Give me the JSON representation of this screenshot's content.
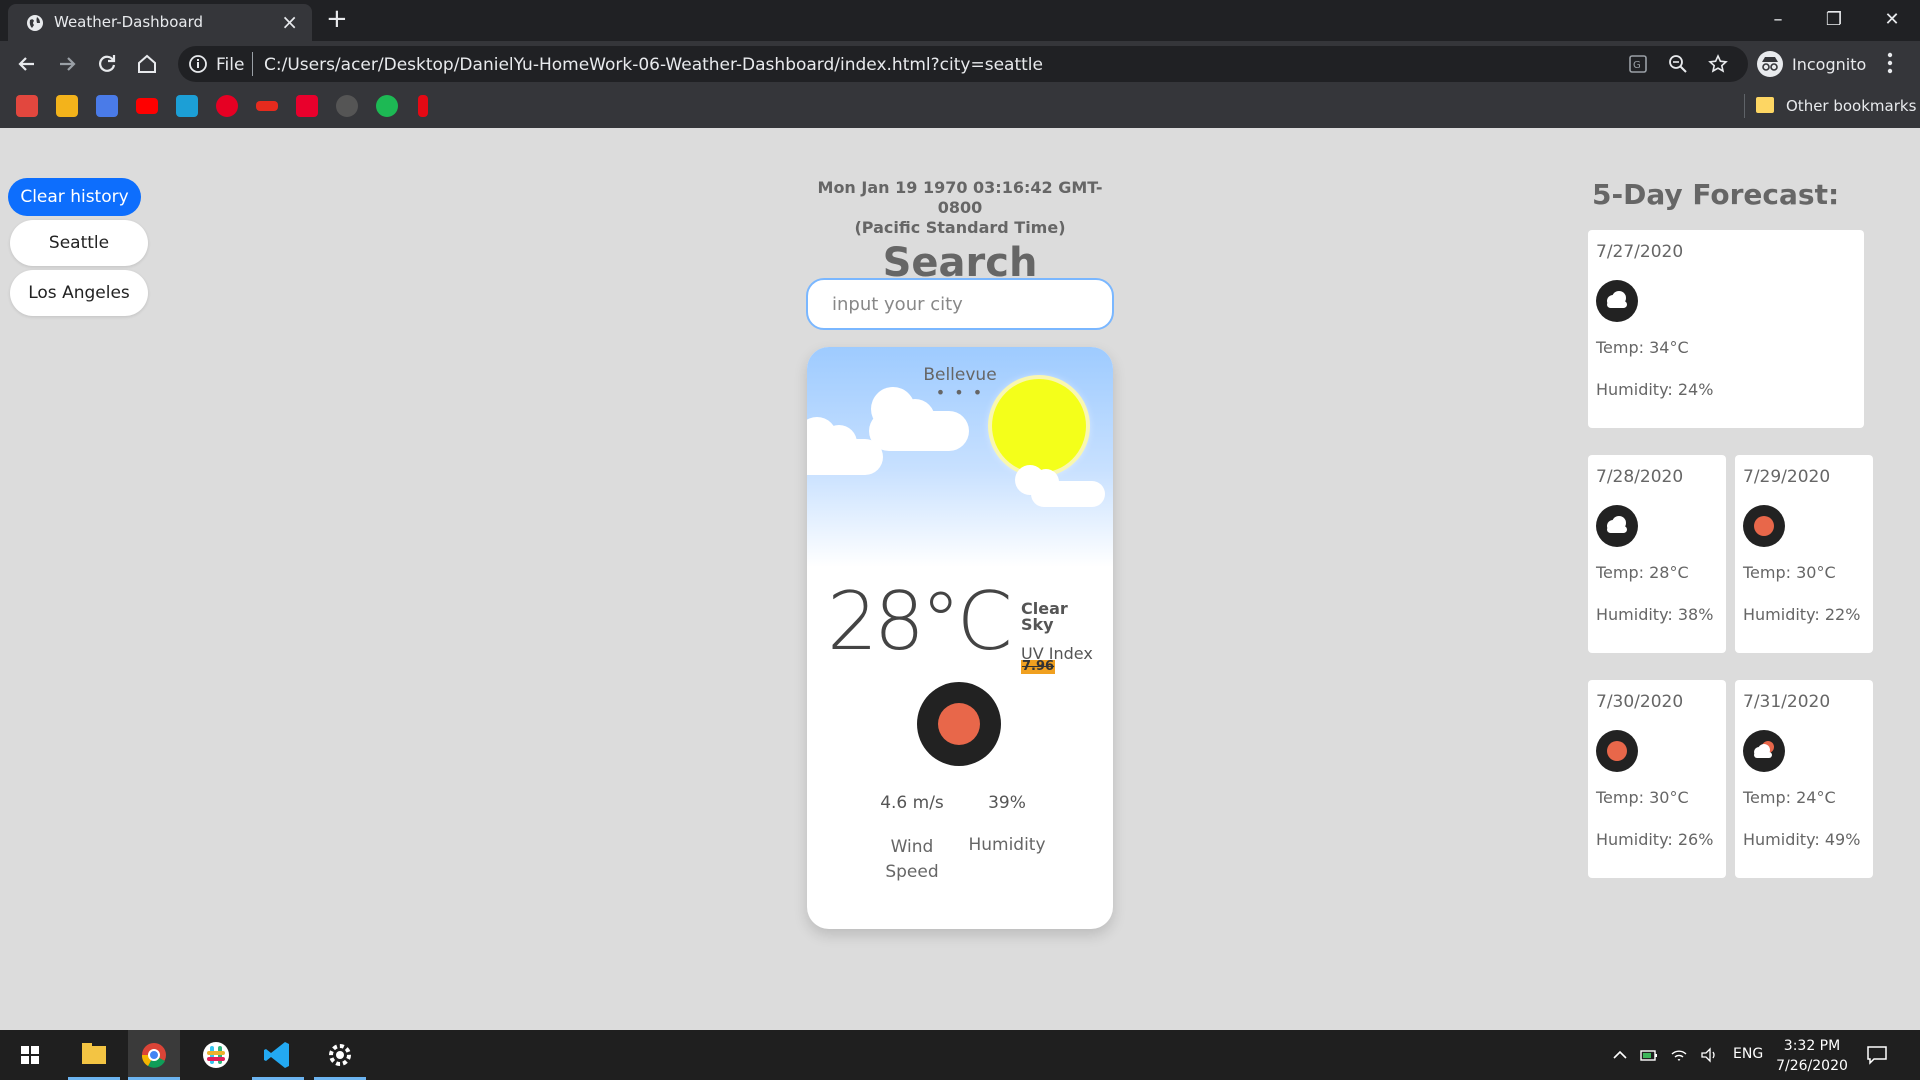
{
  "browser": {
    "tab_title": "Weather-Dashboard",
    "file_label": "File",
    "url": "C:/Users/acer/Desktop/DanielYu-HomeWork-06-Weather-Dashboard/index.html?city=seattle",
    "incognito_label": "Incognito",
    "other_bookmarks": "Other bookmarks",
    "bookmark_icons": [
      "gift-icon",
      "slides-icon",
      "translate-icon",
      "youtube-icon",
      "bookmark-icon",
      "pinterest-icon",
      "ted-icon",
      "m-icon",
      "settings-icon",
      "green-icon",
      "netflix-icon"
    ]
  },
  "history": {
    "clear_label": "Clear history",
    "cities": [
      "Seattle",
      "Los Angeles"
    ]
  },
  "search": {
    "datetime_line1": "Mon Jan 19 1970 03:16:42 GMT-0800",
    "datetime_line2": "(Pacific Standard Time)",
    "title": "Search",
    "placeholder": "input your city"
  },
  "current": {
    "city": "Bellevue",
    "dots": "• • •",
    "temperature": "28°C",
    "condition": "Clear Sky",
    "uv_label": "UV Index",
    "uv_value": "7.96",
    "wind_speed": "4.6 m/s",
    "wind_label": "Wind Speed",
    "humidity": "39%",
    "humidity_label": "Humidity"
  },
  "forecast": {
    "title": "5-Day Forecast:",
    "days": [
      {
        "date": "7/27/2020",
        "icon": "cloud-icon",
        "temp": "Temp: 34°C",
        "humidity": "Humidity: 24%"
      },
      {
        "date": "7/28/2020",
        "icon": "cloud-icon",
        "temp": "Temp: 28°C",
        "humidity": "Humidity: 38%"
      },
      {
        "date": "7/29/2020",
        "icon": "sun-icon",
        "temp": "Temp: 30°C",
        "humidity": "Humidity: 22%"
      },
      {
        "date": "7/30/2020",
        "icon": "sun-icon",
        "temp": "Temp: 30°C",
        "humidity": "Humidity: 26%"
      },
      {
        "date": "7/31/2020",
        "icon": "partly-cloudy-icon",
        "temp": "Temp: 24°C",
        "humidity": "Humidity: 49%"
      }
    ]
  },
  "taskbar": {
    "lang": "ENG",
    "time": "3:32 PM",
    "date": "7/26/2020"
  },
  "colors": {
    "accent": "#0d6efd",
    "sun": "#f4ff1a",
    "icon_dark": "#222222",
    "icon_sun": "#e8674a"
  }
}
